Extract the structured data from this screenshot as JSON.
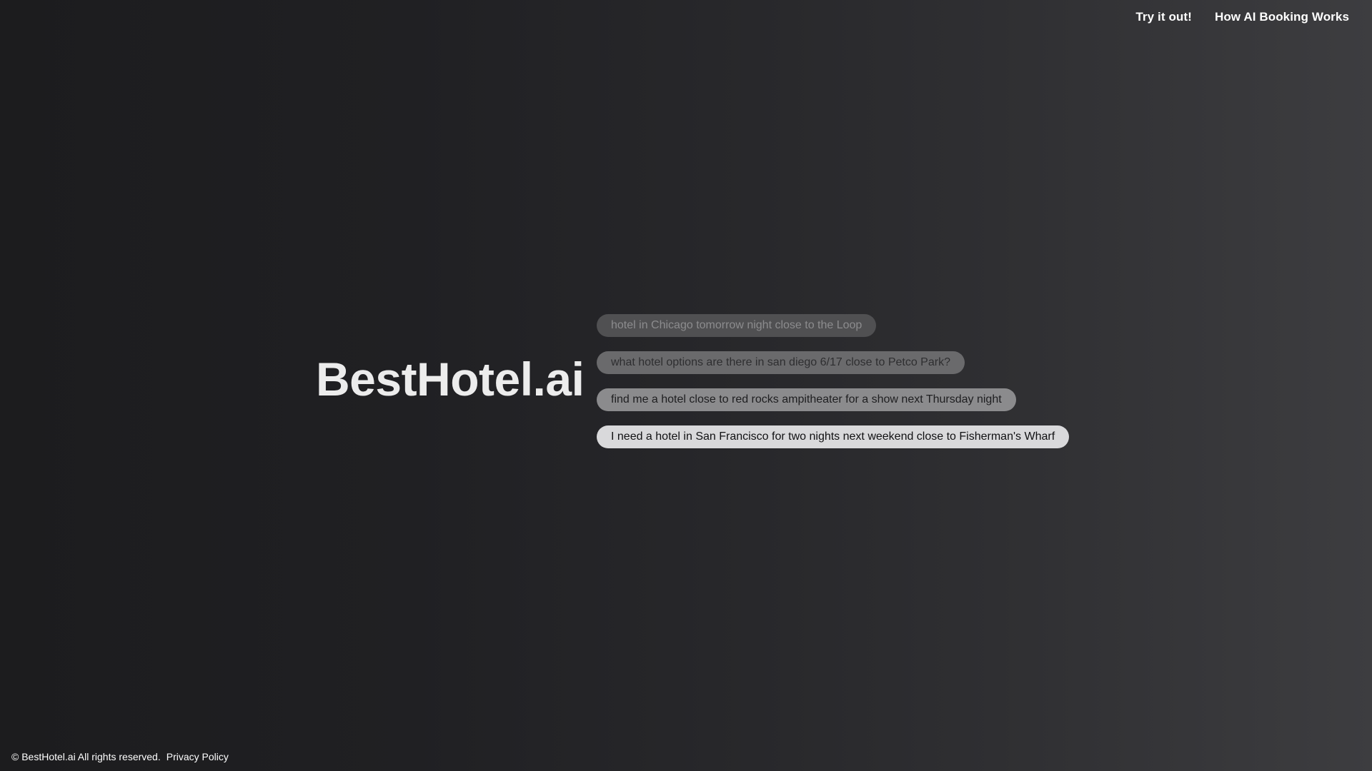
{
  "nav": {
    "try_it_out": "Try it out!",
    "how_it_works": "How AI Booking Works"
  },
  "hero": {
    "logo": "BestHotel.ai",
    "suggestions": [
      "hotel in Chicago tomorrow night close to the Loop",
      "what hotel options are there in san diego 6/17 close to Petco Park?",
      "find me a hotel close to red rocks ampitheater for a show next Thursday night",
      "I need a hotel in San Francisco for two nights next weekend close to Fisherman's Wharf"
    ]
  },
  "footer": {
    "copyright": "© BestHotel.ai All rights reserved.",
    "privacy": "Privacy Policy"
  }
}
